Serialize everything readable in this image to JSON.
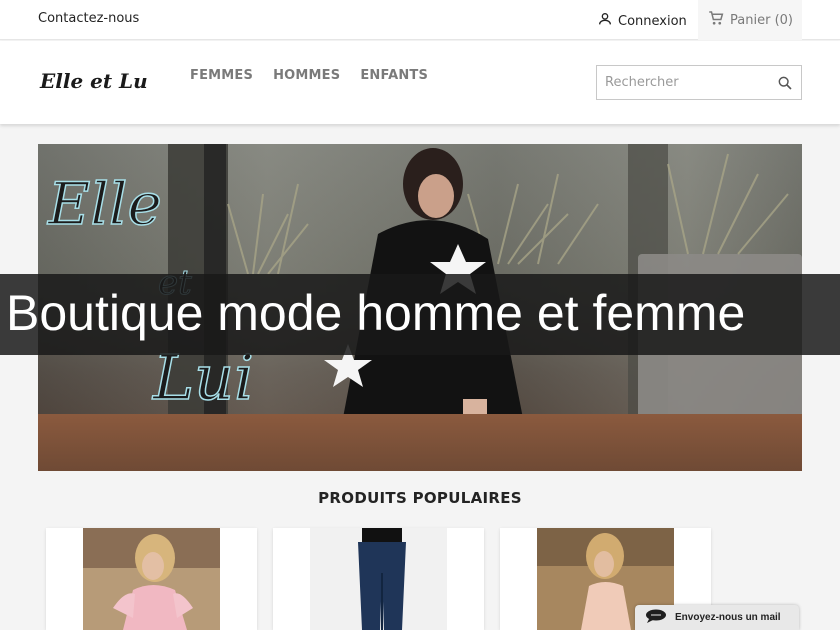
{
  "topbar": {
    "contact_label": "Contactez-nous",
    "login_label": "Connexion",
    "cart_label": "Panier (0)"
  },
  "header": {
    "logo_text": "Elle et Lui",
    "nav": [
      {
        "label": "FEMMES"
      },
      {
        "label": "HOMMES"
      },
      {
        "label": "ENFANTS"
      }
    ],
    "search_placeholder": "Rechercher"
  },
  "banner": {
    "logo_text_top": "Elle",
    "logo_text_mid": "et",
    "logo_text_bottom": "Lui"
  },
  "overlay_title": "Boutique mode homme et femme",
  "products_title": "PRODUITS POPULAIRES",
  "products": [
    {
      "icon": "pink-dress-photo"
    },
    {
      "icon": "blue-jeans-photo"
    },
    {
      "icon": "beige-dress-photo"
    }
  ],
  "mail_button_label": "Envoyez-nous un mail",
  "colors": {
    "accent": "#7a7a7a",
    "overlay": "#191919",
    "text": "#232323"
  }
}
